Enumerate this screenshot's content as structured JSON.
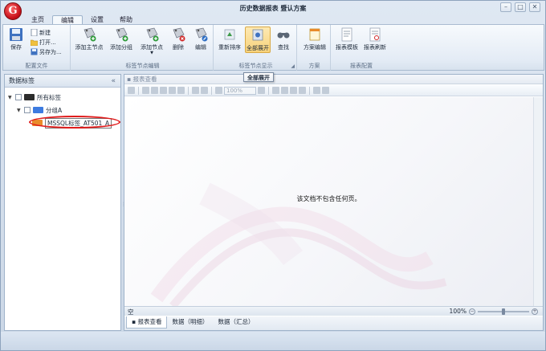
{
  "window": {
    "title": "历史数据报表 暨认方案",
    "logo_letter": "G",
    "controls": {
      "minimize": "–",
      "maximize": "□",
      "close": "✕"
    }
  },
  "tabs": [
    {
      "label": "主页"
    },
    {
      "label": "编辑"
    },
    {
      "label": "设置"
    },
    {
      "label": "帮助"
    }
  ],
  "ribbon": {
    "groups": [
      {
        "label": "配置文件"
      },
      {
        "label": "标签节点编辑"
      },
      {
        "label": "标签节点显示"
      },
      {
        "label": "方案"
      },
      {
        "label": "报表配置"
      }
    ],
    "save": "保存",
    "new": "新建",
    "open": "打开...",
    "save_as": "另存为...",
    "add_main_node": "添加主节点",
    "add_group": "添加分组",
    "add_node": "添加节点",
    "delete": "删除",
    "edit": "编辑",
    "resort": "重新排序",
    "expand_all": "全部展开",
    "find": "查找",
    "scheme_edit": "方案编辑",
    "report_template": "报表模板",
    "report_refresh": "报表刷新"
  },
  "tooltip": "全部展开",
  "left_panel": {
    "title": "数据标签",
    "collapse": "«",
    "tree": {
      "root": "所有标签",
      "group": "分组A",
      "tag": "MSSQL标签_AT501_A"
    }
  },
  "right_panel": {
    "title": "报表查看",
    "zoom_box": "100%",
    "empty_message": "该文档不包含任何页。",
    "status_left": "空",
    "zoom_level": "100%",
    "bottom_tabs": [
      {
        "label": "报表查看"
      },
      {
        "label": "数据（明细）"
      },
      {
        "label": "数据（汇总）"
      }
    ]
  },
  "colors": {
    "accent": "#cfe0f3",
    "highlight_ring": "#e01b1b",
    "logo": "#c8101a"
  }
}
